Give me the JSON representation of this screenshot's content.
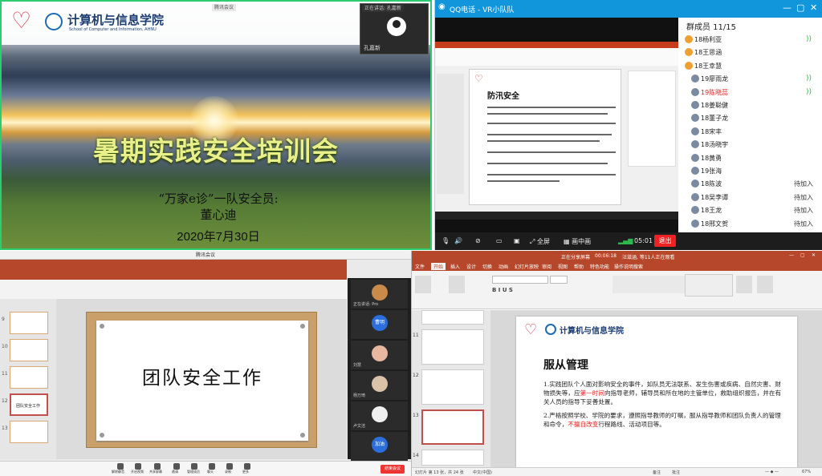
{
  "q1": {
    "school_cn": "计算机与信息学院",
    "school_en": "School of Computer and Information, AHNU",
    "top_tag": "腾讯会议",
    "cam_tag": "正在讲话: 孔嘉新",
    "cam_name": "孔嘉新",
    "title": "暑期实践安全培训会",
    "subtitle": "“万家e诊”一队安全员:",
    "speaker": "董心迪",
    "date": "2020年7月30日"
  },
  "q2": {
    "window_title": "QQ电话 - VR小队队",
    "members_header": "群成员 11/15",
    "members": [
      {
        "name": "18杨利亚",
        "status": "",
        "speaking": true,
        "role": "admin"
      },
      {
        "name": "18王思涵",
        "status": "",
        "speaking": false,
        "role": "admin"
      },
      {
        "name": "18王幸慧",
        "status": "",
        "speaking": false,
        "role": "admin"
      },
      {
        "name": "19廖雨龙",
        "status": "",
        "speaking": true,
        "role": ""
      },
      {
        "name": "19陈晓蕊",
        "status": "",
        "speaking": true,
        "role": "",
        "highlight": true
      },
      {
        "name": "18姜聪健",
        "status": "",
        "speaking": false,
        "role": ""
      },
      {
        "name": "18董子龙",
        "status": "",
        "speaking": false,
        "role": ""
      },
      {
        "name": "18宋丰",
        "status": "",
        "speaking": false,
        "role": ""
      },
      {
        "name": "18汤晓宇",
        "status": "",
        "speaking": false,
        "role": ""
      },
      {
        "name": "18黄勇",
        "status": "",
        "speaking": false,
        "role": ""
      },
      {
        "name": "19张海",
        "status": "",
        "speaking": false,
        "role": ""
      },
      {
        "name": "18陈波",
        "status": "待加入",
        "speaking": false,
        "role": ""
      },
      {
        "name": "18吴李谭",
        "status": "待加入",
        "speaking": false,
        "role": ""
      },
      {
        "name": "18王龙",
        "status": "待加入",
        "speaking": false,
        "role": ""
      },
      {
        "name": "18邢文贺",
        "status": "待加入",
        "speaking": false,
        "role": ""
      }
    ],
    "inner_title": "防汛安全",
    "footer": {
      "fullscreen": "全屏",
      "grid": "画中画",
      "time": "05:01",
      "hangup": "退出"
    }
  },
  "q3": {
    "window_title": "腾讯会议",
    "slide_title": "团队安全工作",
    "thumb_title": "团队安全工作",
    "thumbs": [
      "9",
      "10",
      "11",
      "12",
      "13"
    ],
    "side_names": [
      "正在讲话: Pro",
      "曹明",
      "刘慧",
      "杨万琦",
      "卢文洁",
      "加油"
    ],
    "footer_items": [
      "解除静音",
      "开启视频",
      "共享屏幕",
      "邀请",
      "管理成员",
      "聊天",
      "录制",
      "更多"
    ],
    "end_button": "结束会议"
  },
  "q4": {
    "top_title": "正在分享屏幕",
    "top_time": "00:06:18",
    "top_count": "汪滋涵, 等11人正在观看",
    "tabs": [
      "文件",
      "开始",
      "插入",
      "设计",
      "切换",
      "动画",
      "幻灯片放映",
      "审阅",
      "视图",
      "帮助",
      "特色功能",
      "操作说明搜索"
    ],
    "active_tab": "开始",
    "school_cn": "计算机与信息学院",
    "slide_heading": "服从管理",
    "para1_a": "1.实践团队个人面对影响安全的事件，如队员无法联系、发生伤害或疾病、自然灾害、财物损失等，应",
    "para1_hl": "第一时间",
    "para1_b": "向指导老师，辅导员和所在地的主管单位，救助组织报告，并在有关人员的指导下妥善处置。",
    "para2_a": "2.严格按照学校、学院的要求，遵照指导教师的叮嘱，服从指导教师和团队负责人的管理和命令，",
    "para2_hl": "不擅自改变",
    "para2_b": "行程路线、活动项目等。",
    "thumb_nums": [
      "11",
      "12",
      "13",
      "14"
    ],
    "status_left": "幻灯片 第 13 张，共 24 张",
    "status_lang": "中文(中国)",
    "status_notes": "备注",
    "status_comments": "批注",
    "zoom": "67%"
  },
  "colors": {
    "ppt_red": "#b7472a",
    "qq_blue": "#1296db",
    "accent_green": "#2ecc71",
    "danger": "#e02020"
  }
}
